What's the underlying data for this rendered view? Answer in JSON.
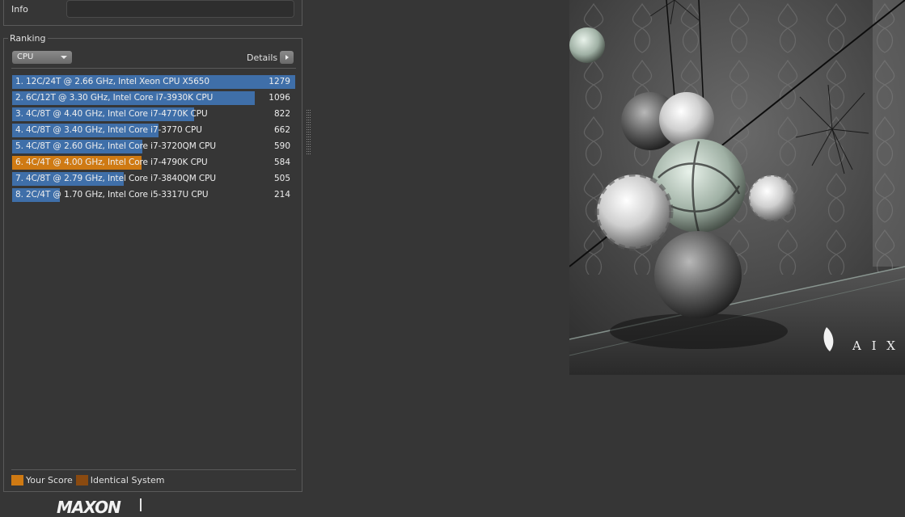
{
  "info": {
    "label": "Info",
    "value": ""
  },
  "ranking": {
    "title": "Ranking",
    "dropdown": {
      "selected": "CPU"
    },
    "details_label": "Details",
    "max_score": 1279,
    "rows": [
      {
        "label": "1. 12C/24T @ 2.66 GHz, Intel Xeon CPU X5650",
        "score": "1279",
        "value": 1279,
        "is_you": false
      },
      {
        "label": "2. 6C/12T @ 3.30 GHz,  Intel Core i7-3930K CPU",
        "score": "1096",
        "value": 1096,
        "is_you": false
      },
      {
        "label": "3. 4C/8T @ 4.40 GHz, Intel Core i7-4770K CPU",
        "score": "822",
        "value": 822,
        "is_you": false
      },
      {
        "label": "4. 4C/8T @ 3.40 GHz,  Intel Core i7-3770 CPU",
        "score": "662",
        "value": 662,
        "is_you": false
      },
      {
        "label": "5. 4C/8T @ 2.60 GHz, Intel Core i7-3720QM CPU",
        "score": "590",
        "value": 590,
        "is_you": false
      },
      {
        "label": "6. 4C/4T @ 4.00 GHz, Intel Core i7-4790K CPU",
        "score": "584",
        "value": 584,
        "is_you": true
      },
      {
        "label": "7. 4C/8T @ 2.79 GHz,  Intel Core i7-3840QM CPU",
        "score": "505",
        "value": 505,
        "is_you": false
      },
      {
        "label": "8. 2C/4T @ 1.70 GHz,  Intel Core i5-3317U CPU",
        "score": "214",
        "value": 214,
        "is_you": false
      }
    ],
    "legend": {
      "your_score": "Your Score",
      "identical_system": "Identical System"
    }
  },
  "branding": {
    "logo_text": "MAXON",
    "render_watermark": "A I X S"
  },
  "colors": {
    "bar_default": "#3f6fa9",
    "bar_your_score": "#cf7a13",
    "identical_system": "#8a4a10",
    "background": "#363636"
  }
}
